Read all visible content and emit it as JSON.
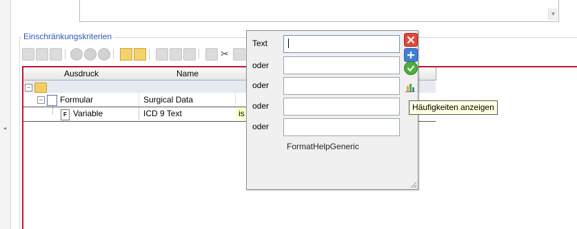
{
  "group": {
    "title": "Einschränkungskriterien"
  },
  "table": {
    "columns": [
      "Ausdruck",
      "Name",
      ""
    ],
    "rows": [
      {
        "expression": "",
        "name": "",
        "value": ""
      },
      {
        "expression": "Formular",
        "name": "Surgical Data",
        "value": ""
      },
      {
        "expression": "Variable",
        "name": "ICD 9 Text",
        "value": "is"
      }
    ]
  },
  "popup": {
    "fields": [
      {
        "label": "Text",
        "value": ""
      },
      {
        "label": "oder",
        "value": ""
      },
      {
        "label": "oder",
        "value": ""
      },
      {
        "label": "oder",
        "value": ""
      },
      {
        "label": "oder",
        "value": ""
      }
    ],
    "format_text": "FormatHelpGeneric",
    "buttons": [
      "close-icon",
      "add-icon",
      "confirm-icon",
      "frequency-chart-icon"
    ]
  },
  "tooltip": {
    "text": "Häufigkeiten anzeigen"
  },
  "colors": {
    "accent_red": "#c8102e",
    "group_title": "#2c56b8",
    "tooltip_bg": "#ffffe1",
    "close_red": "#e0483a"
  }
}
